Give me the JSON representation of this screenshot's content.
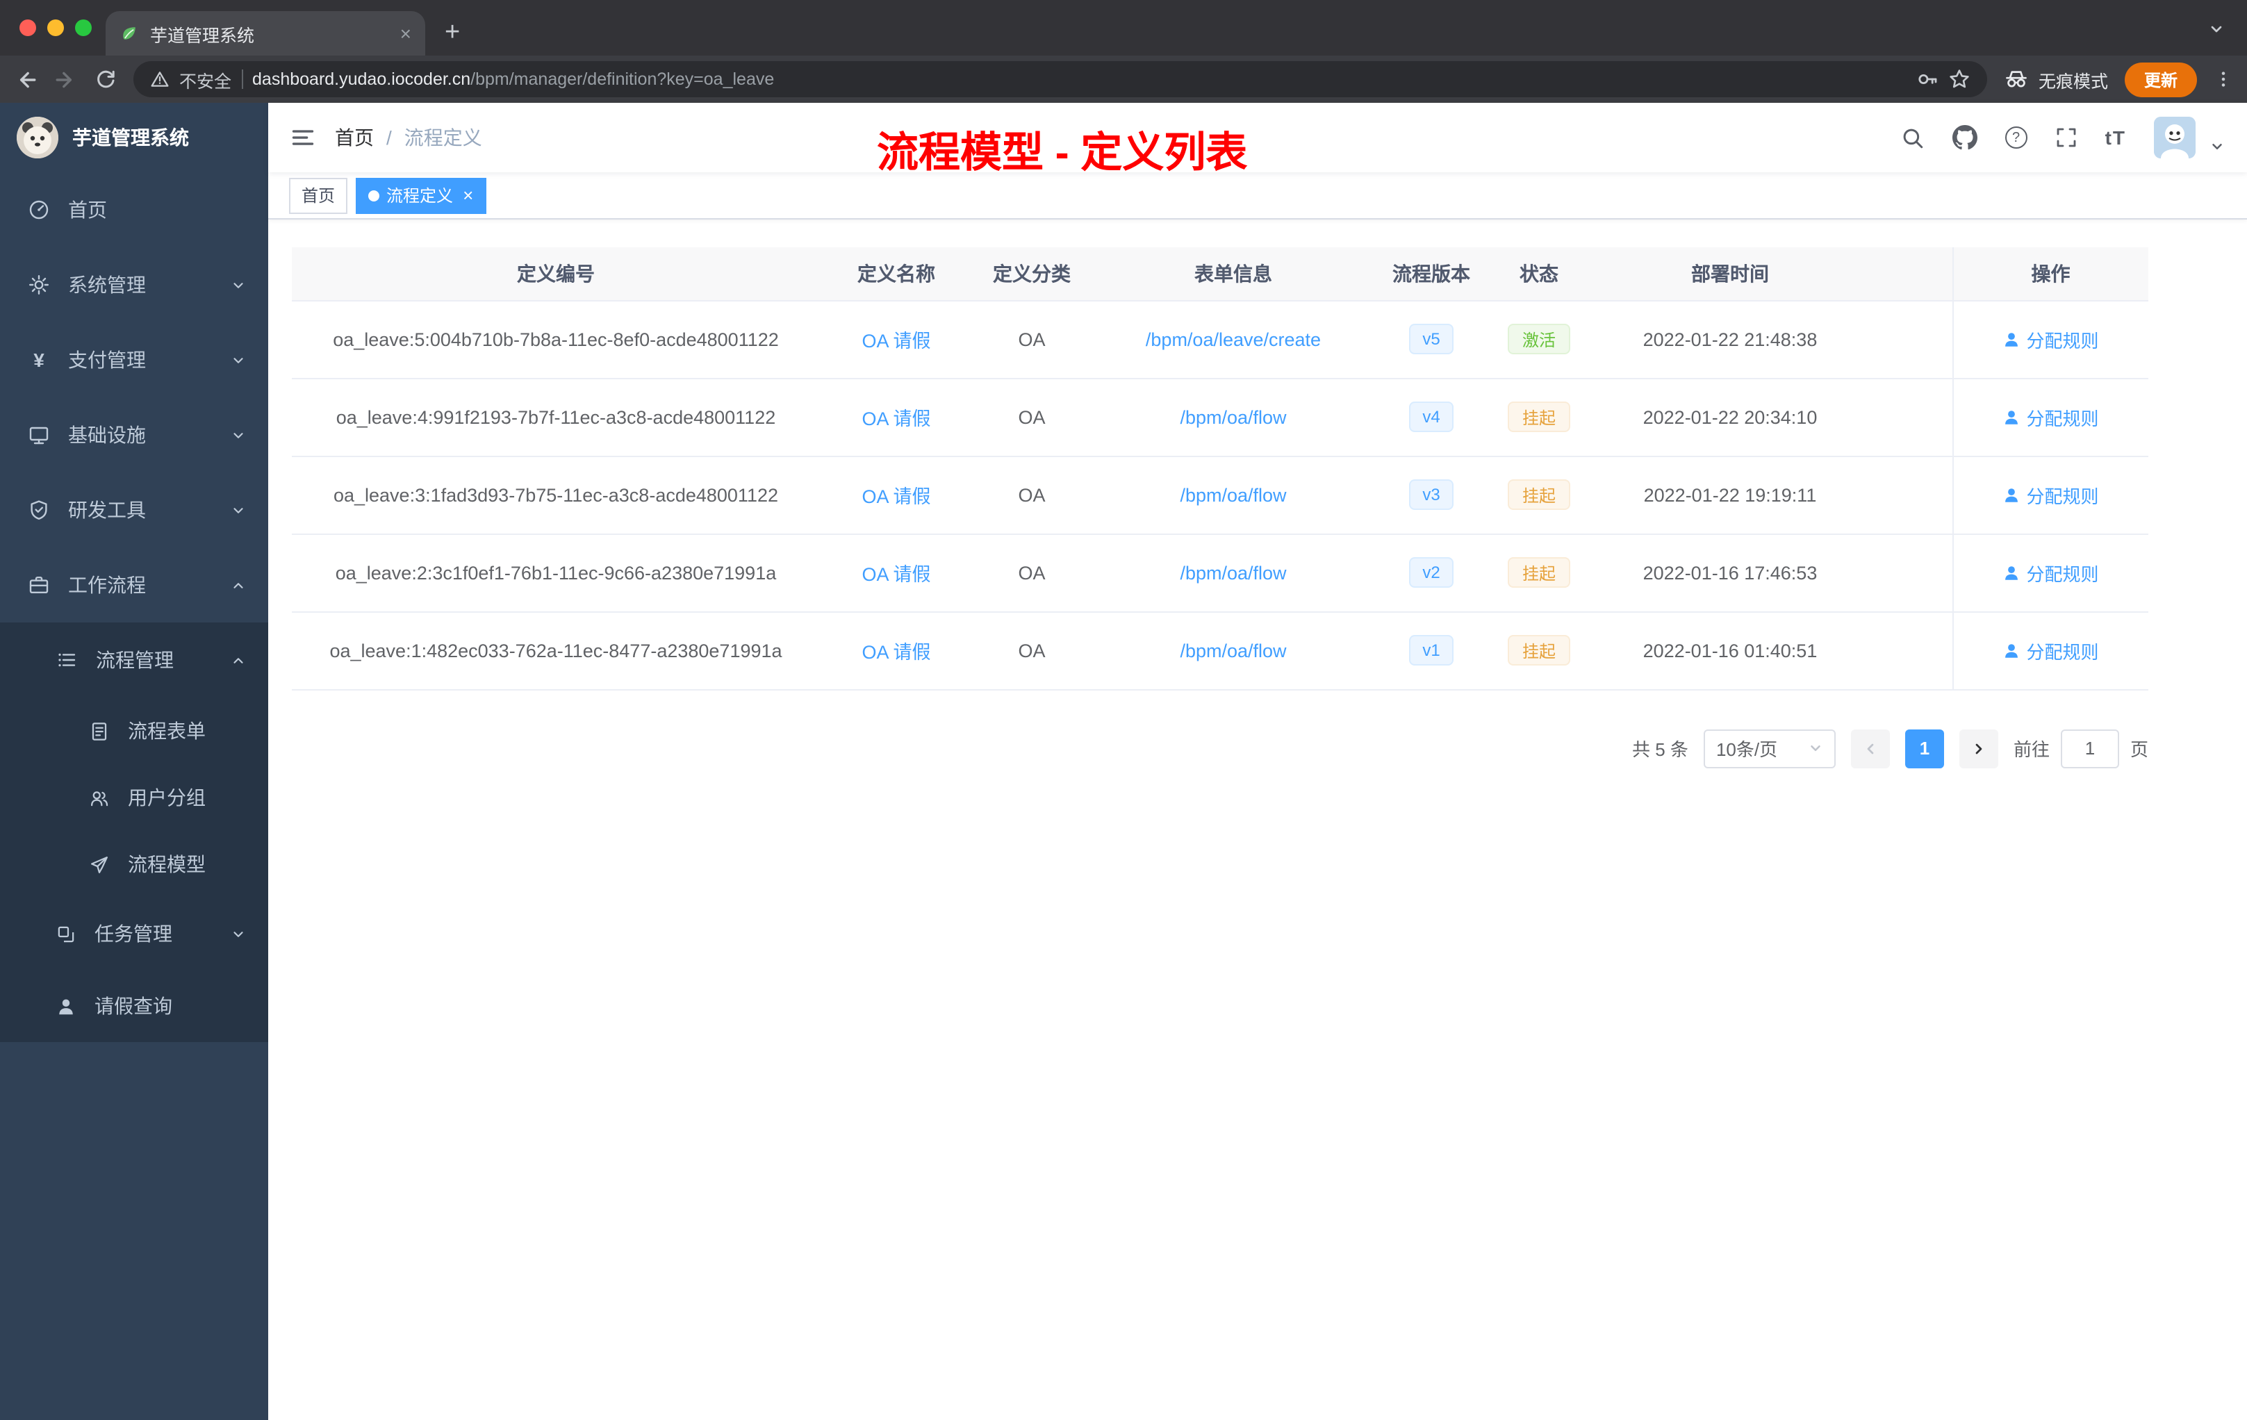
{
  "colors": {
    "accent": "#409eff",
    "success": "#67c23a",
    "warning": "#e6a23c",
    "annotation_red": "#ff0000",
    "sidebar_bg": "#304156",
    "submenu_bg": "#263445"
  },
  "icons": {
    "close_tab": "×",
    "new_tab": "+",
    "tag_close": "×",
    "font_size": "tT",
    "question_mark": "?",
    "yen": "¥"
  },
  "chrome": {
    "tab_title": "芋道管理系统",
    "security_label": "不安全",
    "url_host": "dashboard.yudao.iocoder.cn",
    "url_path": "/bpm/manager/definition?key=oa_leave",
    "incognito_label": "无痕模式",
    "update_label": "更新"
  },
  "sidebar": {
    "title": "芋道管理系统",
    "items": [
      {
        "label": "首页"
      },
      {
        "label": "系统管理"
      },
      {
        "label": "支付管理"
      },
      {
        "label": "基础设施"
      },
      {
        "label": "研发工具"
      },
      {
        "label": "工作流程"
      }
    ],
    "sub": {
      "process_mgmt": "流程管理",
      "children": [
        {
          "label": "流程表单"
        },
        {
          "label": "用户分组"
        },
        {
          "label": "流程模型"
        }
      ],
      "task_mgmt": "任务管理",
      "leave_query": "请假查询"
    }
  },
  "header": {
    "breadcrumb_home": "首页",
    "breadcrumb_sep": "/",
    "breadcrumb_current": "流程定义",
    "annotation": "流程模型 - 定义列表"
  },
  "tags": {
    "home": "首页",
    "active": "流程定义"
  },
  "table": {
    "columns": {
      "id": "定义编号",
      "name": "定义名称",
      "category": "定义分类",
      "form": "表单信息",
      "version": "流程版本",
      "status": "状态",
      "deploy_time": "部署时间",
      "action": "操作"
    },
    "rows": [
      {
        "id": "oa_leave:5:004b710b-7b8a-11ec-8ef0-acde48001122",
        "name": "OA 请假",
        "category": "OA",
        "form": "/bpm/oa/leave/create",
        "version": "v5",
        "status": "激活",
        "time": "2022-01-22 21:48:38",
        "action": "分配规则"
      },
      {
        "id": "oa_leave:4:991f2193-7b7f-11ec-a3c8-acde48001122",
        "name": "OA 请假",
        "category": "OA",
        "form": "/bpm/oa/flow",
        "version": "v4",
        "status": "挂起",
        "time": "2022-01-22 20:34:10",
        "action": "分配规则"
      },
      {
        "id": "oa_leave:3:1fad3d93-7b75-11ec-a3c8-acde48001122",
        "name": "OA 请假",
        "category": "OA",
        "form": "/bpm/oa/flow",
        "version": "v3",
        "status": "挂起",
        "time": "2022-01-22 19:19:11",
        "action": "分配规则"
      },
      {
        "id": "oa_leave:2:3c1f0ef1-76b1-11ec-9c66-a2380e71991a",
        "name": "OA 请假",
        "category": "OA",
        "form": "/bpm/oa/flow",
        "version": "v2",
        "status": "挂起",
        "time": "2022-01-16 17:46:53",
        "action": "分配规则"
      },
      {
        "id": "oa_leave:1:482ec033-762a-11ec-8477-a2380e71991a",
        "name": "OA 请假",
        "category": "OA",
        "form": "/bpm/oa/flow",
        "version": "v1",
        "status": "挂起",
        "time": "2022-01-16 01:40:51",
        "action": "分配规则"
      }
    ]
  },
  "pagination": {
    "total": "共 5 条",
    "page_size": "10条/页",
    "current_page": "1",
    "goto_label": "前往",
    "goto_value": "1",
    "page_unit": "页"
  }
}
